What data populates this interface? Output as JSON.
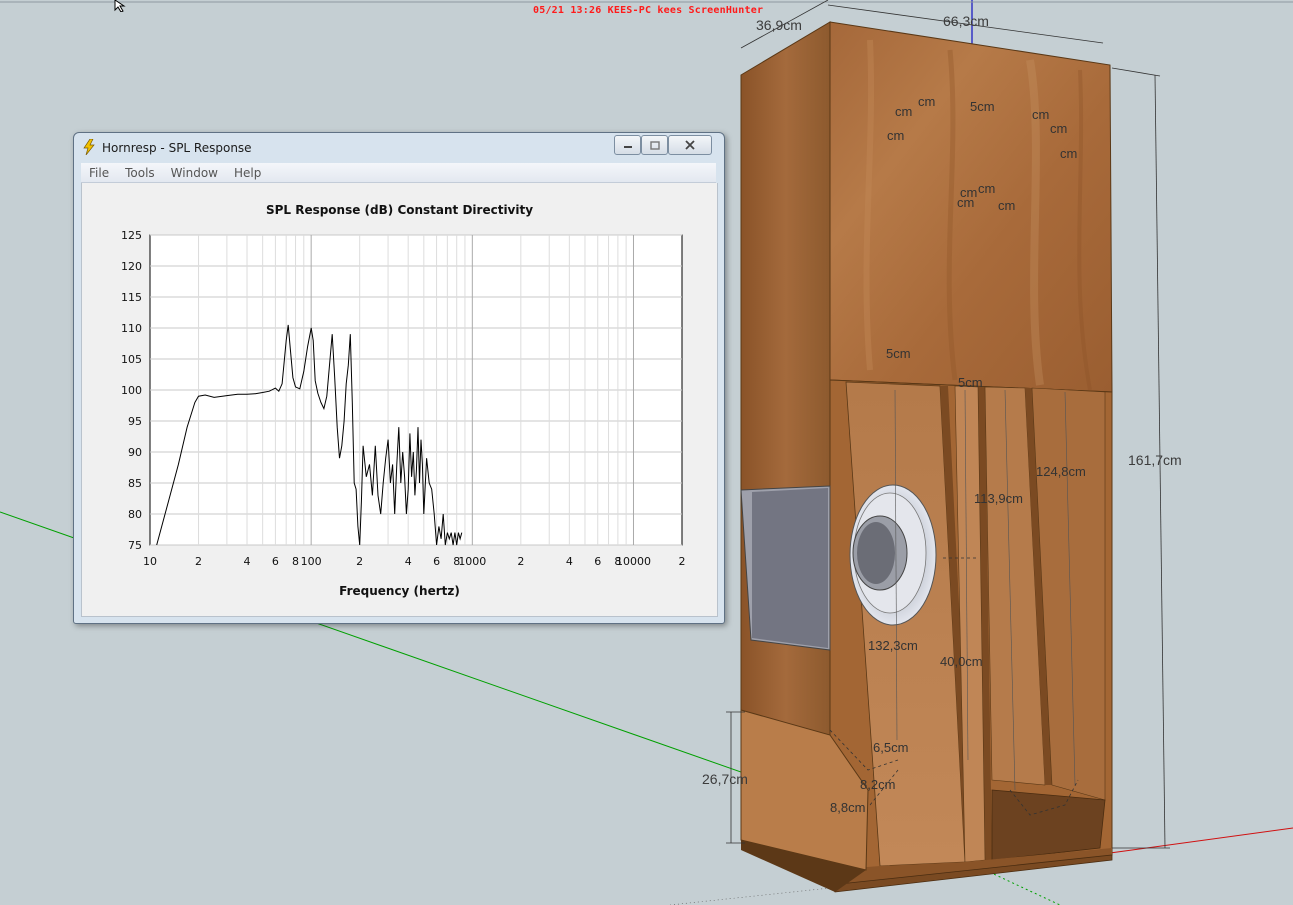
{
  "watermark": "05/21 13:26 KEES-PC kees ScreenHunter",
  "window": {
    "title": "Hornresp - SPL Response",
    "menu": [
      "File",
      "Tools",
      "Window",
      "Help"
    ]
  },
  "dimensions": {
    "depth": "36,9cm",
    "width": "66,3cm",
    "height": "161,7cm",
    "d_124_8": "124,8cm",
    "d_113_9": "113,9cm",
    "d_132_3": "132,3cm",
    "d_40_0": "40,0cm",
    "d_26_7": "26,7cm",
    "d_6_5": "6,5cm",
    "d_8_2": "8,2cm",
    "d_8_8": "8,8cm",
    "d_5_a": "5cm",
    "d_5_b": "5cm",
    "d_5_c": "5cm",
    "cm_1": "cm",
    "cm_2": "cm",
    "cm_3": "cm",
    "cm_4": "cm",
    "cm_5": "cm",
    "cm_6": "cm",
    "cm_7": "cm",
    "cm_8": "cm",
    "cm_9": "cm",
    "cm_10": "cm"
  },
  "colors": {
    "background": "#c5cfd3",
    "wood": "#a86a38",
    "wood_dark": "#7a4a22",
    "axis_green": "#00a000",
    "axis_red": "#d01010",
    "axis_blue": "#1010c0"
  },
  "chart_data": {
    "type": "line",
    "title": "SPL Response (dB)   Constant Directivity",
    "xlabel": "Frequency (hertz)",
    "ylabel": "",
    "x_scale": "log",
    "xlim": [
      10,
      20000
    ],
    "ylim": [
      75,
      125
    ],
    "yticks": [
      75,
      80,
      85,
      90,
      95,
      100,
      105,
      110,
      115,
      120,
      125
    ],
    "xtick_labels": [
      {
        "v": 10,
        "t": "10"
      },
      {
        "v": 20,
        "t": "2"
      },
      {
        "v": 40,
        "t": "4"
      },
      {
        "v": 60,
        "t": "6"
      },
      {
        "v": 80,
        "t": "8"
      },
      {
        "v": 100,
        "t": "100"
      },
      {
        "v": 200,
        "t": "2"
      },
      {
        "v": 400,
        "t": "4"
      },
      {
        "v": 600,
        "t": "6"
      },
      {
        "v": 800,
        "t": "8"
      },
      {
        "v": 1000,
        "t": "1000"
      },
      {
        "v": 2000,
        "t": "2"
      },
      {
        "v": 4000,
        "t": "4"
      },
      {
        "v": 6000,
        "t": "6"
      },
      {
        "v": 8000,
        "t": "8"
      },
      {
        "v": 10000,
        "t": "10000"
      },
      {
        "v": 20000,
        "t": "2"
      }
    ],
    "grid": true,
    "series": [
      {
        "x": [
          11,
          13,
          15,
          17,
          19,
          20,
          22,
          25,
          30,
          35,
          40,
          45,
          50,
          55,
          60,
          63,
          66,
          70,
          72,
          74,
          77,
          80,
          85,
          90,
          95,
          100,
          103,
          106,
          110,
          115,
          120,
          125,
          130,
          135,
          140,
          145,
          150,
          155,
          160,
          165,
          170,
          175,
          180,
          185,
          190,
          195,
          200,
          205,
          210,
          220,
          230,
          240,
          250,
          260,
          270,
          280,
          290,
          300,
          310,
          320,
          330,
          340,
          350,
          360,
          370,
          380,
          390,
          400,
          410,
          420,
          430,
          440,
          450,
          460,
          470,
          480,
          490,
          500,
          520,
          540,
          560,
          580,
          600,
          620,
          640,
          660,
          680,
          700,
          720,
          740,
          760,
          780,
          800,
          820,
          840,
          860
        ],
        "y": [
          75,
          82,
          88,
          94,
          98,
          99,
          99.2,
          98.8,
          99.1,
          99.3,
          99.3,
          99.4,
          99.6,
          99.8,
          100.3,
          99.8,
          101,
          108,
          110.5,
          107,
          102,
          100.5,
          100.2,
          103,
          107,
          110,
          108,
          101.5,
          99.5,
          98,
          97,
          99,
          104,
          109,
          102,
          94,
          89,
          91,
          95,
          101,
          104,
          109,
          98,
          85,
          84,
          78,
          75,
          82,
          91,
          86,
          88,
          83,
          91,
          83,
          80,
          85,
          89,
          92,
          85,
          88,
          80,
          88,
          94,
          85,
          90,
          86,
          80,
          84,
          93,
          86,
          90,
          83,
          87,
          94,
          85,
          92,
          88,
          80,
          89,
          85,
          84,
          80,
          75,
          78,
          76,
          80,
          75,
          77,
          76,
          77,
          75,
          77,
          75,
          77,
          76,
          77
        ]
      }
    ]
  }
}
